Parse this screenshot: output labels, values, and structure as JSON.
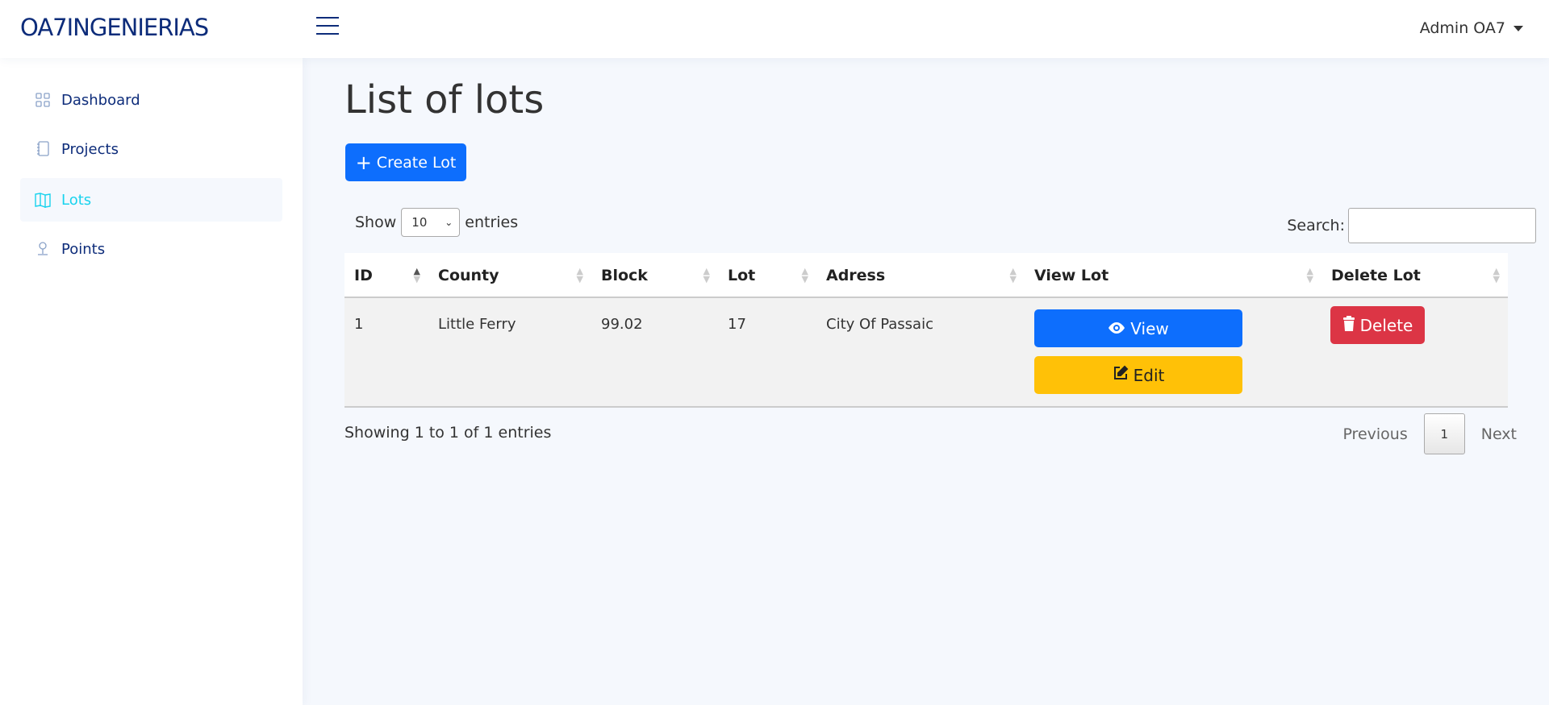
{
  "header": {
    "brand": "OA7INGENIERIAS",
    "user_name": "Admin OA7"
  },
  "sidebar": {
    "items": [
      {
        "label": "Dashboard",
        "icon": "grid-icon",
        "active": false
      },
      {
        "label": "Projects",
        "icon": "notebook-icon",
        "active": false
      },
      {
        "label": "Lots",
        "icon": "map-icon",
        "active": true
      },
      {
        "label": "Points",
        "icon": "pin-icon",
        "active": false
      }
    ]
  },
  "main": {
    "title": "List of lots",
    "create_button": "Create Lot",
    "show_label": "Show",
    "entries_label": "entries",
    "page_size": "10",
    "search_label": "Search:",
    "search_value": "",
    "table": {
      "columns": [
        "ID",
        "County",
        "Block",
        "Lot",
        "Adress",
        "View Lot",
        "Delete Lot"
      ],
      "rows": [
        {
          "id": "1",
          "county": "Little Ferry",
          "block": "99.02",
          "lot": "17",
          "address": "City Of Passaic",
          "view_label": "View",
          "edit_label": "Edit",
          "delete_label": "Delete"
        }
      ]
    },
    "info": "Showing 1 to 1 of 1 entries",
    "pagination": {
      "previous": "Previous",
      "current": "1",
      "next": "Next"
    }
  },
  "colors": {
    "brand": "#0d2c7a",
    "active_nav": "#19d3ee",
    "primary": "#0d6efd",
    "warning": "#ffc107",
    "danger": "#dc3545"
  }
}
